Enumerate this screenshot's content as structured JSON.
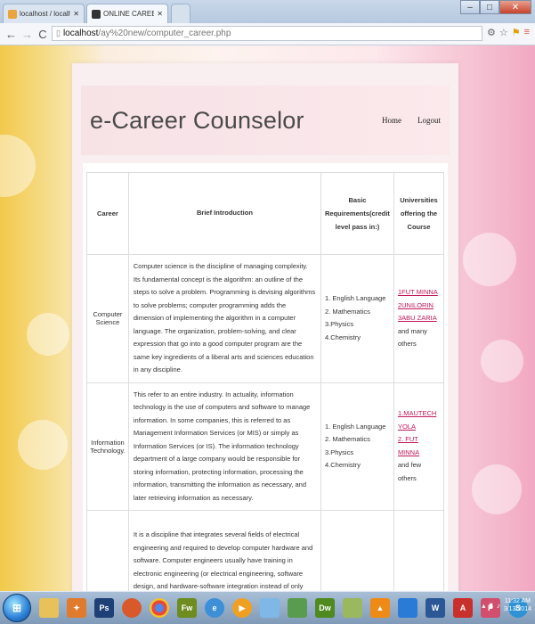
{
  "browser": {
    "tabs": [
      {
        "label": "localhost / localhost / car"
      },
      {
        "label": "ONLINE CAREER GUIDAN"
      }
    ],
    "url_host": "localhost",
    "url_path": "/ay%20new/computer_career.php"
  },
  "site": {
    "logo": "e-Career Counselor",
    "nav": [
      {
        "label": "Home"
      },
      {
        "label": "Logout"
      }
    ]
  },
  "table": {
    "headers": {
      "career": "Career",
      "intro": "Brief Introduction",
      "req": "Basic Requirements(credit level pass in:)",
      "uni": "Universities offering the Course"
    },
    "rows": [
      {
        "career": "Computer Science",
        "intro": "Computer science is the discipline of managing complexity. Its fundamental concept is the algorithm: an outline of the steps to solve a problem. Programming is devising algorithms to solve problems; computer programming adds the dimension of implementing the algorithm in a computer language. The organization, problem-solving, and clear expression that go into a good computer program are the same key ingredients of a liberal arts and sciences education in any discipline.",
        "req": [
          "1. English Language",
          "2. Mathematics",
          "3.Physics",
          "4.Chemistry"
        ],
        "uni_links": [
          "1FUT MINNA",
          "2UNILORIN",
          "3ABU ZARIA"
        ],
        "uni_tail": "and many others"
      },
      {
        "career": "Information Technology.",
        "intro": "This refer to an entire industry. In actuality, information technology is the use of computers and software to manage information. In some companies, this is referred to as Management Information Services (or MIS) or simply as Information Services (or IS). The information technology department of a large company would be responsible for storing information, protecting information, processing the information, transmitting the information as necessary, and later retrieving information as necessary.",
        "req": [
          "1. English Language",
          "2. Mathematics",
          "3.Physics",
          "4.Chemistry"
        ],
        "uni_links": [
          "1.MAUTECH YOLA",
          "2. FUT MINNA"
        ],
        "uni_tail": "and few others"
      },
      {
        "career": "",
        "intro": "It is a discipline that integrates several fields of electrical engineering and required to develop computer hardware and software. Computer engineers usually have training in electronic engineering (or electrical engineering, software design, and hardware-software integration instead of only software engineering or electronic engineering. Computer engineers are involved in many hardware and software aspects of",
        "req": [],
        "uni_links": [],
        "uni_tail": ""
      }
    ]
  },
  "taskbar": {
    "clock_time": "11:32 AM",
    "clock_date": "3/13/2014"
  }
}
